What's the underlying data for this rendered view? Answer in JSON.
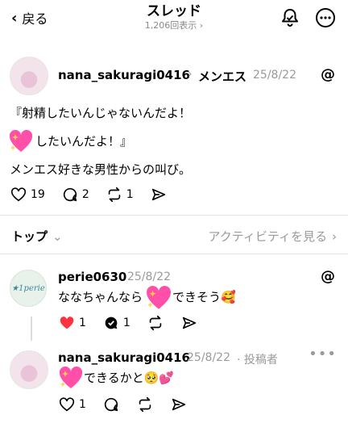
{
  "header": {
    "back_label": "戻る",
    "title": "スレッド",
    "views": "1,206回表示 ›"
  },
  "post": {
    "username": "nana_sakuragi0416",
    "separator": "›",
    "topic": "メンエス",
    "date": "25/8/22",
    "lines": [
      "『射精したいんじゃないんだよ！",
      "したいんだよ！』",
      "メンエス好きな男性からの叫び。"
    ],
    "likes": "19",
    "comments": "2",
    "reposts": "1"
  },
  "tabbar": {
    "sort_label": "トップ",
    "activity_label": "アクティビティを見る"
  },
  "replies": [
    {
      "username": "perie0630",
      "date": "25/8/22",
      "avatar_text": "★1perie",
      "text_before": "ななちゃんなら",
      "text_after": "できそう🥰",
      "likes": "1",
      "comments": "1"
    },
    {
      "username": "nana_sakuragi0416",
      "date": "25/8/22",
      "author_tag": "· 投稿者",
      "text_after": "できるかと🥺💕",
      "likes": "1"
    }
  ],
  "colors": {
    "like_red": "#ff3040",
    "muted": "#9a9a9a",
    "heart_pink": "#ff4fa8"
  }
}
